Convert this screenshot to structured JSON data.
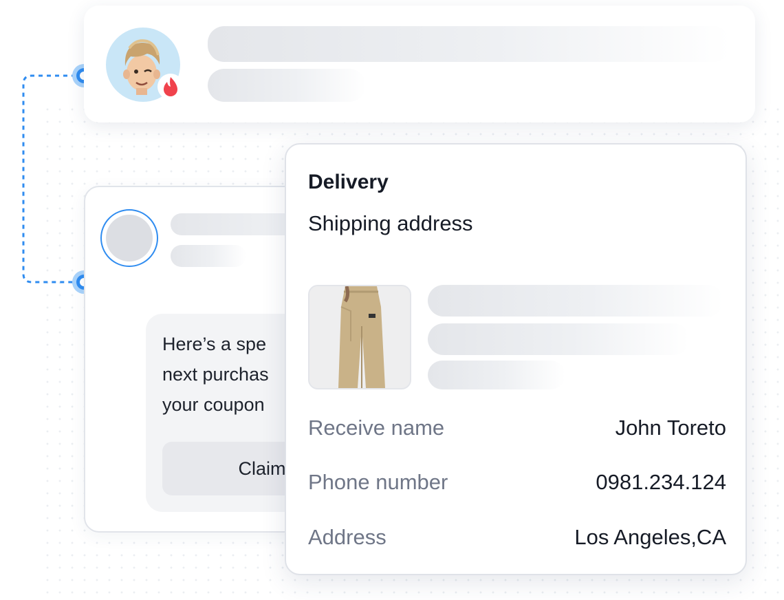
{
  "delivery": {
    "title": "Delivery",
    "subtitle": "Shipping address",
    "fields": [
      {
        "label": "Receive name",
        "value": "John Toreto"
      },
      {
        "label": "Phone number",
        "value": "0981.234.124"
      },
      {
        "label": "Address",
        "value": "Los Angeles,CA"
      }
    ]
  },
  "chat": {
    "message": "Here’s a spe\nnext purchas\nyour coupon",
    "button_label": "Claim"
  },
  "colors": {
    "accent": "#2f8cf0",
    "badge": "#f0424c",
    "skeleton": "#e4e6ea"
  },
  "icons": {
    "avatar": "memoji-avatar-icon",
    "badge": "flame-badge-icon",
    "product": "pants-product-image"
  }
}
